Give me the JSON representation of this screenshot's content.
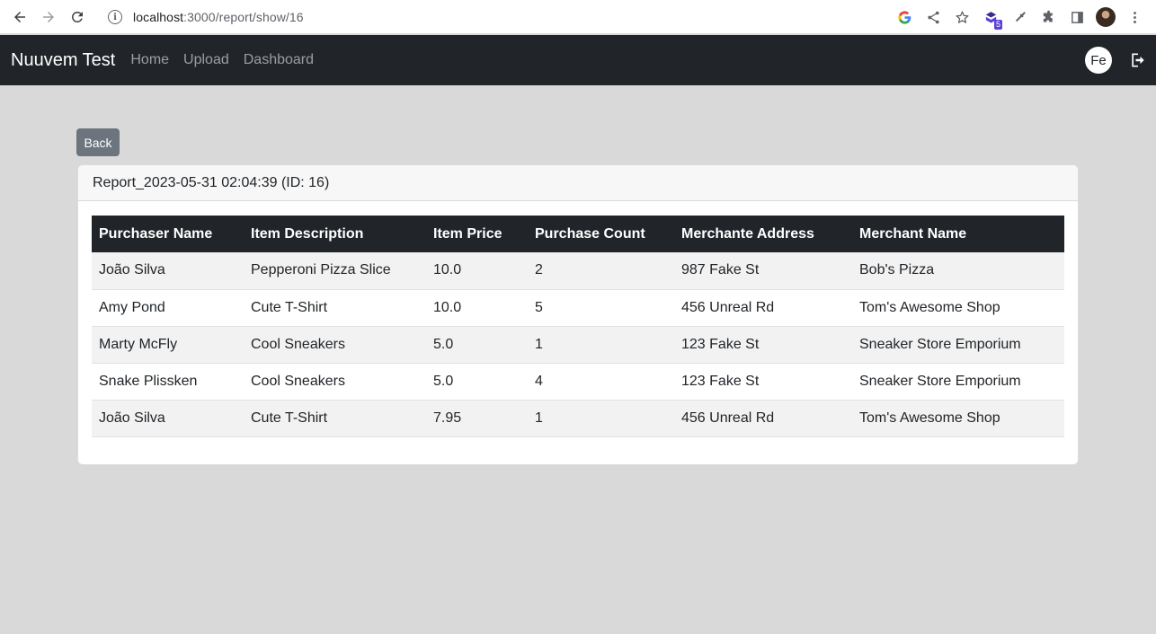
{
  "browser": {
    "url_host": "localhost",
    "url_rest": ":3000/report/show/16",
    "extension_badge": "5"
  },
  "navbar": {
    "brand": "Nuuvem Test",
    "links": [
      "Home",
      "Upload",
      "Dashboard"
    ],
    "user_initials": "Fe"
  },
  "back_label": "Back",
  "report": {
    "title": "Report_2023-05-31 02:04:39 (ID: 16)",
    "columns": [
      "Purchaser Name",
      "Item Description",
      "Item Price",
      "Purchase Count",
      "Merchante Address",
      "Merchant Name"
    ],
    "rows": [
      [
        "João Silva",
        "Pepperoni Pizza Slice",
        "10.0",
        "2",
        "987 Fake St",
        "Bob's Pizza"
      ],
      [
        "Amy Pond",
        "Cute T-Shirt",
        "10.0",
        "5",
        "456 Unreal Rd",
        "Tom's Awesome Shop"
      ],
      [
        "Marty McFly",
        "Cool Sneakers",
        "5.0",
        "1",
        "123 Fake St",
        "Sneaker Store Emporium"
      ],
      [
        "Snake Plissken",
        "Cool Sneakers",
        "5.0",
        "4",
        "123 Fake St",
        "Sneaker Store Emporium"
      ],
      [
        "João Silva",
        "Cute T-Shirt",
        "7.95",
        "1",
        "456 Unreal Rd",
        "Tom's Awesome Shop"
      ]
    ]
  },
  "colors": {
    "navbar_bg": "#212529",
    "page_bg": "#d9d9d9",
    "back_button": "#6c757d"
  }
}
